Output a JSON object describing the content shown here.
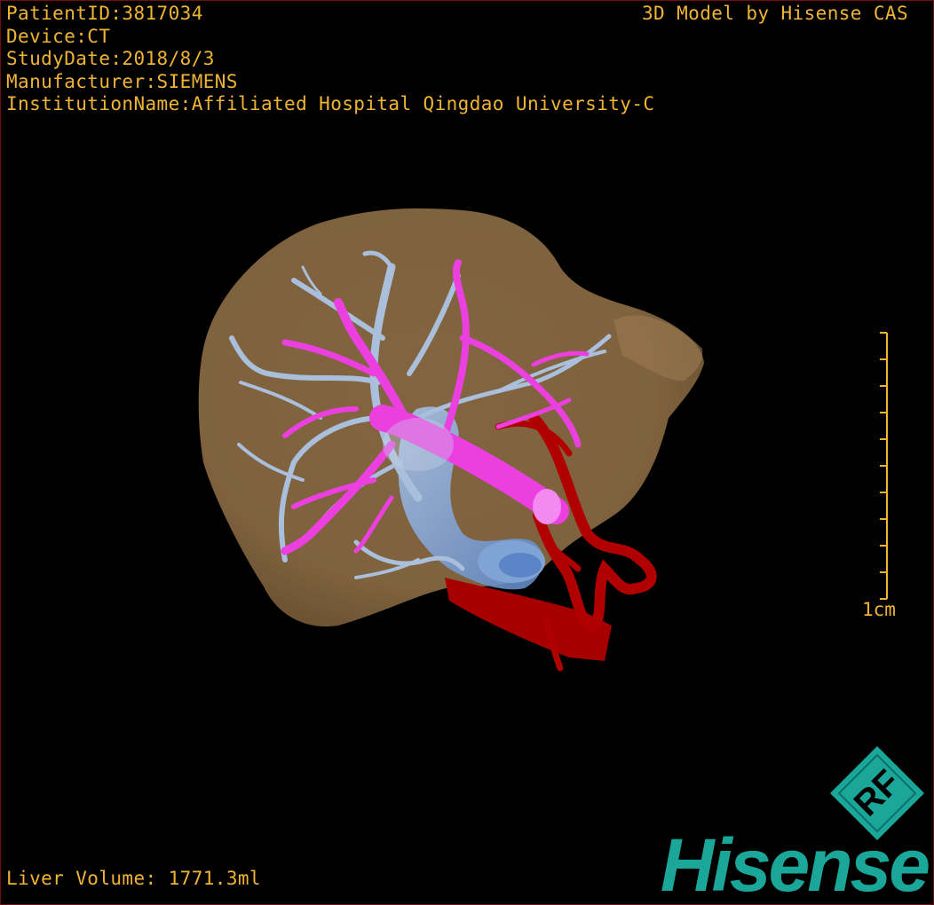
{
  "patient_info": {
    "lines": [
      "PatientID:3817034",
      "Device:CT",
      "StudyDate:2018/8/3",
      "Manufacturer:SIEMENS",
      "InstitutionName:Affiliated Hospital Qingdao University-C"
    ]
  },
  "credit": "3D Model by Hisense CAS",
  "scale": {
    "label": "1cm"
  },
  "volume": "Liver Volume: 1771.3ml",
  "logo": {
    "badge_text": "RF",
    "brand": "Hisense"
  },
  "colors": {
    "text": "#f0b434",
    "liver": "#8a6a43",
    "hepatic_vein": "#9fb7d6",
    "portal_vein": "#ec3fe0",
    "artery": "#b00000",
    "vena_cava": "#7fa3d4",
    "brand": "#1aa79a"
  }
}
